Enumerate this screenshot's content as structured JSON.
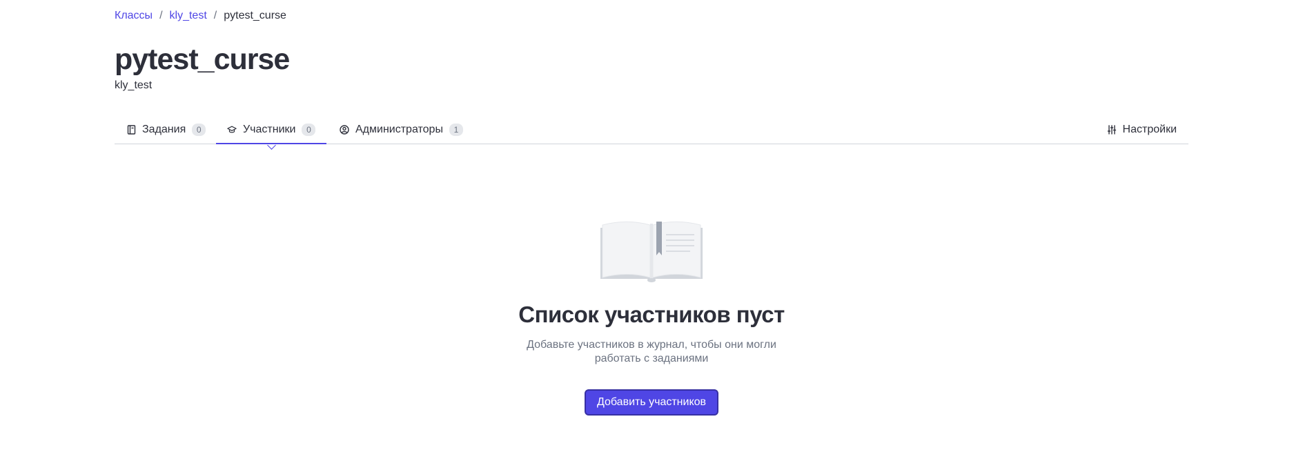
{
  "breadcrumb": {
    "items": [
      "Классы",
      "kly_test"
    ],
    "separator": "/",
    "current": "pytest_curse"
  },
  "header": {
    "title": "pytest_curse",
    "subtitle": "kly_test"
  },
  "tabs": [
    {
      "label": "Задания",
      "count": "0",
      "icon": "book-icon",
      "active": false
    },
    {
      "label": "Участники",
      "count": "0",
      "icon": "graduation-cap-icon",
      "active": true
    },
    {
      "label": "Администраторы",
      "count": "1",
      "icon": "user-circle-icon",
      "active": false
    }
  ],
  "settings": {
    "label": "Настройки",
    "icon": "sliders-icon"
  },
  "empty_state": {
    "illustration": "open-book-illustration",
    "title": "Список участников пуст",
    "text": "Добавьте участников в журнал, чтобы они могли работать с заданиями",
    "button_label": "Добавить участников"
  },
  "colors": {
    "accent": "#4f46e5",
    "text": "#2d2f3a",
    "muted": "#6b7280",
    "border": "#d1d5db"
  }
}
